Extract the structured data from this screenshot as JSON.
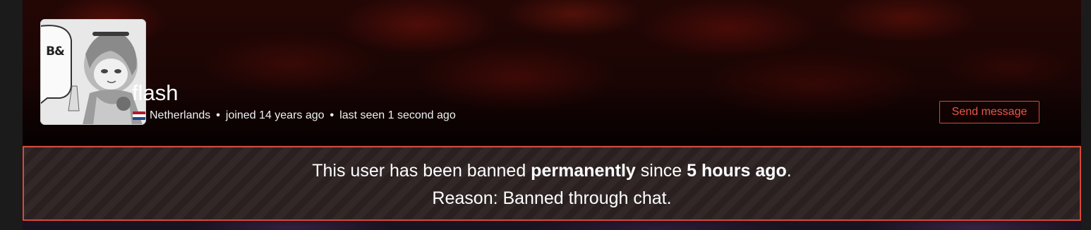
{
  "profile": {
    "avatar_caption": "B&",
    "username": "flash",
    "country": "Netherlands",
    "joined": "joined 14 years ago",
    "last_seen": "last seen 1 second ago",
    "separator": "•",
    "flag_colors": [
      "#ae1c28",
      "#ffffff",
      "#21468b"
    ]
  },
  "actions": {
    "send_message_label": "Send message"
  },
  "ban": {
    "line1_prefix": "This user has been banned ",
    "line1_duration": "permanently",
    "line1_mid": " since ",
    "line1_since": "5 hours ago",
    "line1_suffix": ".",
    "line2": "Reason: Banned through chat."
  },
  "colors": {
    "accent_red": "#d9483a",
    "banner_dark": "#1a0504"
  }
}
